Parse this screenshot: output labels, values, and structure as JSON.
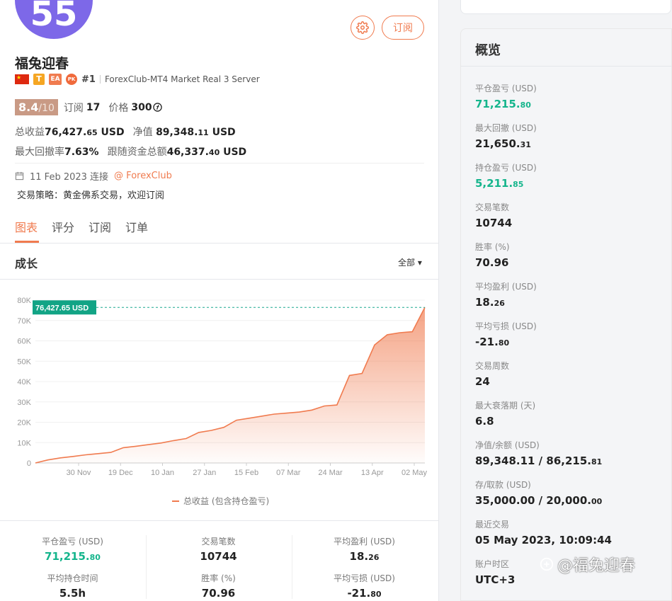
{
  "profile": {
    "avatar_text": "55",
    "title": "福兔迎春",
    "rank": "#1",
    "server": "ForexClub-MT4 Market Real 3 Server",
    "badge_t": "T",
    "badge_ea": "EA",
    "badge_pk": "PK",
    "score": "8.4",
    "score_max": "/10",
    "subs_label": "订阅",
    "subs_value": "17",
    "price_label": "价格",
    "price_value": "300",
    "total_profit_label": "总收益",
    "total_profit_int": "76,427.",
    "total_profit_dec": "65",
    "total_profit_unit": "USD",
    "equity_label": "净值",
    "equity_int": "89,348.",
    "equity_dec": "11",
    "equity_unit": "USD",
    "drawdown_label": "最大回撤率",
    "drawdown_value": "7.63%",
    "follow_label": "跟随资金总额",
    "follow_int": "46,337.",
    "follow_dec": "40",
    "follow_unit": "USD",
    "connected": "11 Feb 2023 连接",
    "broker": "@ ForexClub",
    "strategy": "交易策略：黄金佛系交易，欢迎订阅"
  },
  "buttons": {
    "subscribe": "订阅"
  },
  "tabs": [
    "图表",
    "评分",
    "订阅",
    "订单"
  ],
  "growth": {
    "title": "成长",
    "filter": "全部 ▾"
  },
  "chart_data": {
    "type": "area",
    "title": "成长",
    "x_ticks": [
      "30 Nov",
      "19 Dec",
      "10 Jan",
      "27 Jan",
      "15 Feb",
      "07 Mar",
      "24 Mar",
      "13 Apr",
      "02 May"
    ],
    "y_ticks": [
      "0",
      "10K",
      "20K",
      "30K",
      "40K",
      "50K",
      "60K",
      "70K",
      "80K"
    ],
    "ylim": [
      0,
      80000
    ],
    "series": [
      {
        "name": "总收益 (包含持仓盈亏)",
        "color": "#f07b4f",
        "values": [
          0,
          1500,
          2500,
          3200,
          4000,
          4600,
          5200,
          7500,
          8200,
          9000,
          9800,
          11000,
          12000,
          15000,
          16000,
          17500,
          21000,
          22000,
          23000,
          24000,
          24500,
          25000,
          26000,
          28000,
          28500,
          43000,
          44000,
          58000,
          63000,
          64000,
          64500,
          76427.65
        ]
      }
    ],
    "last_label": "76,427.65 USD"
  },
  "bottom_stats": [
    {
      "label": "平仓盈亏 (USD)",
      "int": "71,215.",
      "dec": "80",
      "green": true
    },
    {
      "label": "交易笔数",
      "int": "10744",
      "dec": "",
      "green": false
    },
    {
      "label": "平均盈利 (USD)",
      "int": "18.",
      "dec": "26",
      "green": false
    },
    {
      "label": "平均持仓时间",
      "int": "5.5h",
      "dec": "",
      "green": false
    },
    {
      "label": "胜率 (%)",
      "int": "70.96",
      "dec": "",
      "green": false
    },
    {
      "label": "平均亏损 (USD)",
      "int": "-21.",
      "dec": "80",
      "green": false
    }
  ],
  "overview": {
    "title": "概览",
    "items": [
      {
        "label": "平仓盈亏 (USD)",
        "int": "71,215.",
        "dec": "80",
        "green": true
      },
      {
        "label": "最大回撤 (USD)",
        "int": "21,650.",
        "dec": "31",
        "green": false
      },
      {
        "label": "持仓盈亏 (USD)",
        "int": "5,211.",
        "dec": "85",
        "green": true
      },
      {
        "label": "交易笔数",
        "int": "10744",
        "dec": "",
        "green": false
      },
      {
        "label": "胜率 (%)",
        "int": "70.96",
        "dec": "",
        "green": false
      },
      {
        "label": "平均盈利 (USD)",
        "int": "18.",
        "dec": "26",
        "green": false
      },
      {
        "label": "平均亏损 (USD)",
        "int": "-21.",
        "dec": "80",
        "green": false
      },
      {
        "label": "交易周数",
        "int": "24",
        "dec": "",
        "green": false
      },
      {
        "label": "最大衰落期 (天)",
        "int": "6.8",
        "dec": "",
        "green": false
      },
      {
        "label": "净值/余额 (USD)",
        "int": "89,348.11 / 86,215.",
        "dec": "81",
        "green": false
      },
      {
        "label": "存/取款 (USD)",
        "int": "35,000.00 / 20,000.",
        "dec": "00",
        "green": false
      },
      {
        "label": "最近交易",
        "int": "05 May 2023, 10:09:44",
        "dec": "",
        "green": false
      },
      {
        "label": "账户时区",
        "int": "UTC+3",
        "dec": "",
        "green": false
      }
    ]
  },
  "watermark": "@福兔迎春"
}
